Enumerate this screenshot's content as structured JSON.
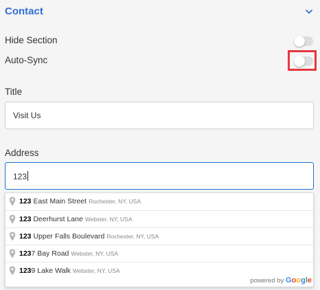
{
  "section": {
    "title": "Contact"
  },
  "hide_section": {
    "label": "Hide Section",
    "enabled": false
  },
  "auto_sync": {
    "label": "Auto-Sync",
    "enabled": false
  },
  "title_field": {
    "label": "Title",
    "value": "Visit Us"
  },
  "address_field": {
    "label": "Address",
    "value": "123"
  },
  "suggestions": [
    {
      "match": "123",
      "main": " East Main Street",
      "secondary": "Rochester, NY, USA"
    },
    {
      "match": "123",
      "main": " Deerhurst Lane",
      "secondary": "Webster, NY, USA"
    },
    {
      "match": "123",
      "main": " Upper Falls Boulevard",
      "secondary": "Rochester, NY, USA"
    },
    {
      "match": "123",
      "main": "7 Bay Road",
      "secondary": "Webster, NY, USA"
    },
    {
      "match": "123",
      "main": "9 Lake Walk",
      "secondary": "Webster, NY, USA"
    }
  ],
  "attribution": {
    "prefix": "powered by",
    "brand": "Google"
  },
  "colors": {
    "accent": "#2f6fd6",
    "highlight": "#e5373d",
    "focus_border": "#1c6fd1",
    "google": [
      "#4285F4",
      "#EA4335",
      "#FBBC05",
      "#4285F4",
      "#34A853",
      "#EA4335"
    ]
  },
  "icons": {
    "collapse": "chevron-down-icon",
    "suggestion": "map-pin-icon"
  }
}
